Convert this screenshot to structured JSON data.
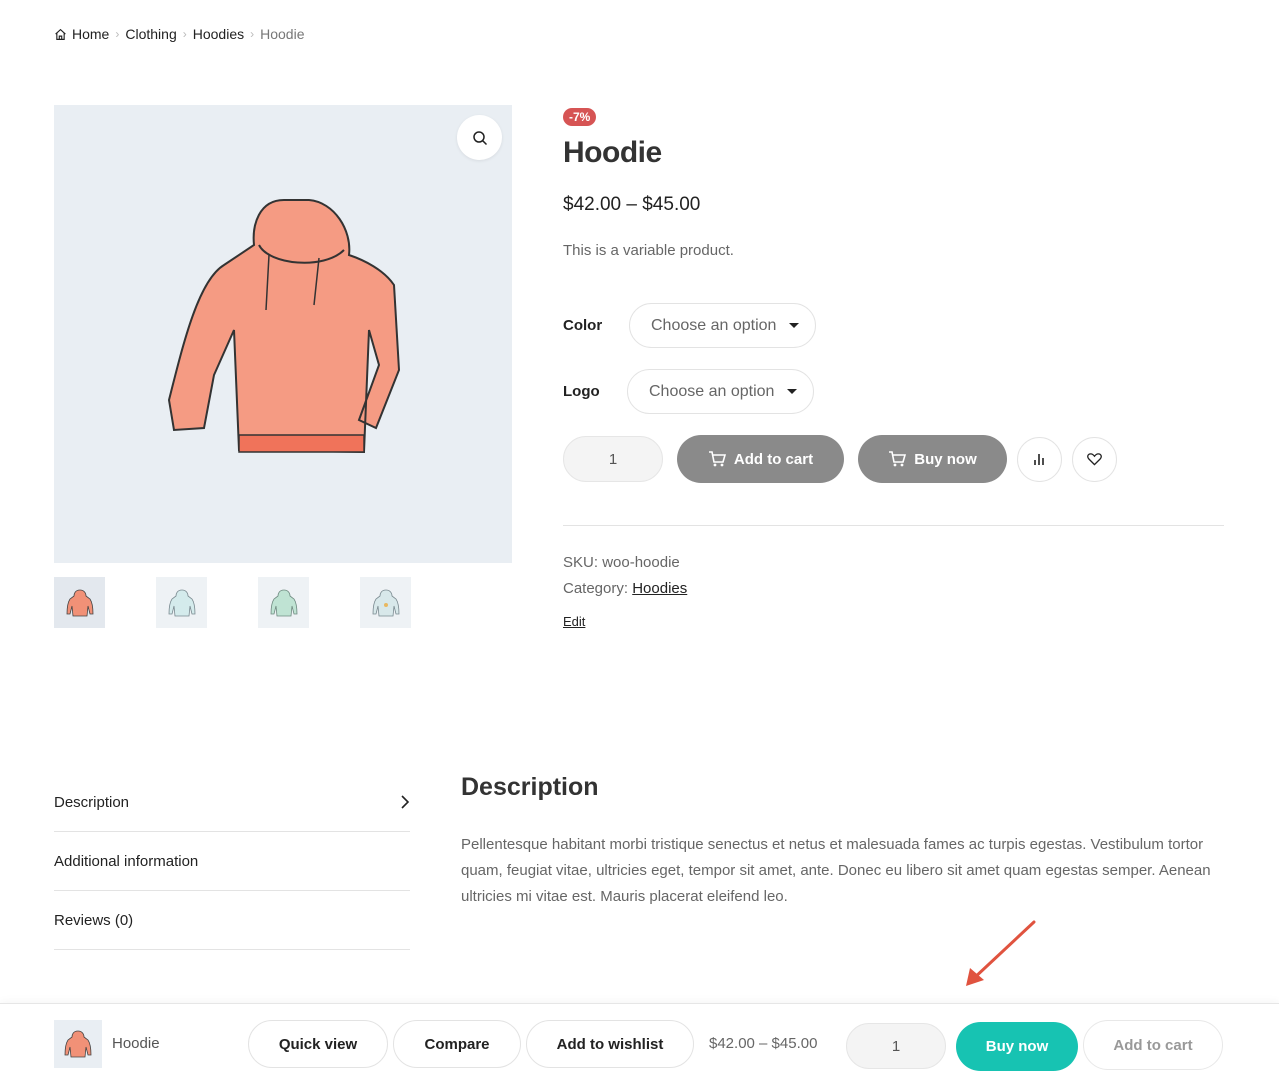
{
  "breadcrumb": {
    "home": "Home",
    "items": [
      "Clothing",
      "Hoodies"
    ],
    "current": "Hoodie"
  },
  "product": {
    "badge": "-7%",
    "title": "Hoodie",
    "price": "$42.00 – $45.00",
    "short_description": "This is a variable product."
  },
  "variations": [
    {
      "label": "Color",
      "placeholder": "Choose an option"
    },
    {
      "label": "Logo",
      "placeholder": "Choose an option"
    }
  ],
  "actions": {
    "quantity": "1",
    "add_to_cart": "Add to cart",
    "buy_now": "Buy now",
    "compare_icon": "bar-chart-icon",
    "wishlist_icon": "heart-icon"
  },
  "meta": {
    "sku_label": "SKU:",
    "sku_value": "woo-hoodie",
    "category_label": "Category:",
    "category_value": "Hoodies",
    "edit": "Edit"
  },
  "tabs": [
    {
      "label": "Description"
    },
    {
      "label": "Additional information"
    },
    {
      "label": "Reviews (0)"
    }
  ],
  "description": {
    "heading": "Description",
    "text": "Pellentesque habitant morbi tristique senectus et netus et malesuada fames ac turpis egestas. Vestibulum tortor quam, feugiat vitae, ultricies eget, tempor sit amet, ante. Donec eu libero sit amet quam egestas semper. Aenean ultricies mi vitae est. Mauris placerat eleifend leo."
  },
  "sticky_bar": {
    "name": "Hoodie",
    "quick_view": "Quick view",
    "compare": "Compare",
    "add_to_wishlist": "Add to wishlist",
    "price": "$42.00 – $45.00",
    "quantity": "1",
    "buy_now": "Buy now",
    "add_to_cart": "Add to cart"
  },
  "colors": {
    "sale_badge": "#d65454",
    "buy_now_accent": "#17c3b2",
    "disabled_button": "#8a8a8a",
    "gallery_bg": "#e9eef3",
    "annotation_arrow": "#e0533f"
  }
}
